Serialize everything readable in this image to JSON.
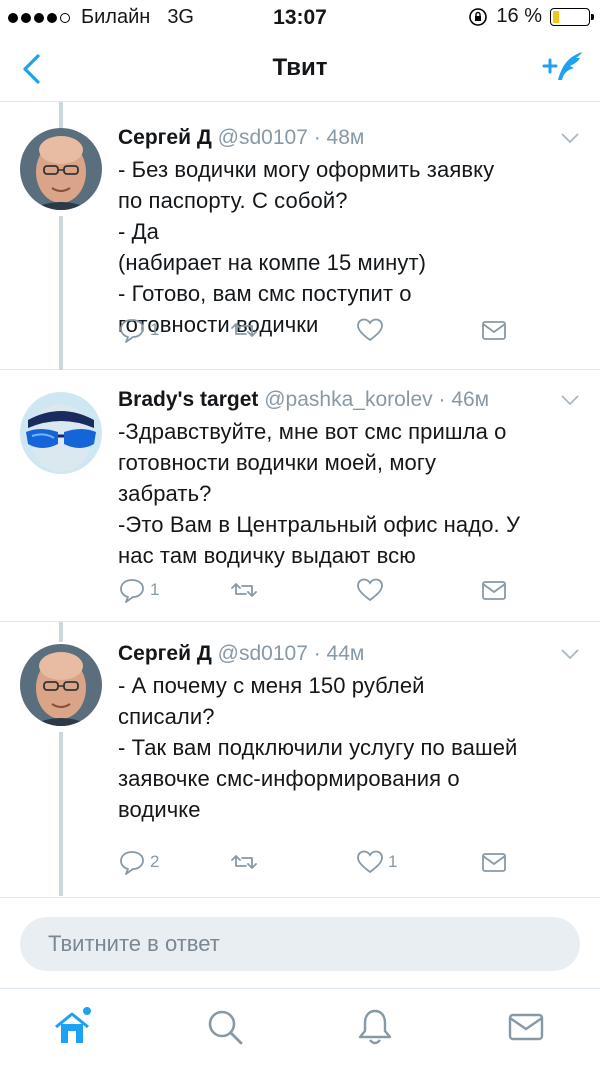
{
  "status_bar": {
    "carrier": "Билайн",
    "network": "3G",
    "time": "13:07",
    "battery_text": "16 %",
    "battery_level": 0.16,
    "signal_bars": 4
  },
  "nav": {
    "title": "Твит",
    "back_icon": "chevron-left-icon",
    "compose_icon": "compose-tweet-icon"
  },
  "tweets": [
    {
      "name": "Сергей Д",
      "handle": "@sd0107",
      "time": "· 48м",
      "text": "- Без водички могу оформить заявку\nпо паспорту. С собой?\n- Да\n(набирает на компе 15 минут)\n- Готово, вам смс поступит о\nготовности водички",
      "replies": "1",
      "retweets": "",
      "likes": "",
      "avatar": "bald-man-glasses"
    },
    {
      "name": "Brady's target",
      "handle": "@pashka_korolev",
      "time": "· 46м",
      "text": "-Здравствуйте, мне вот смс пришла о\nготовности водички моей, могу\nзабрать?\n-Это Вам в Центральный офис надо. У\nнас там водичку выдают всю",
      "replies": "1",
      "retweets": "",
      "likes": "",
      "avatar": "blue-sunglasses"
    },
    {
      "name": "Сергей Д",
      "handle": "@sd0107",
      "time": "· 44м",
      "text": "- А почему с меня 150 рублей\nсписали?\n- Так вам подключили услугу по вашей\nзаявочке смс-информирования о\nводичке",
      "replies": "2",
      "retweets": "",
      "likes": "1",
      "avatar": "bald-man-glasses"
    }
  ],
  "reply": {
    "placeholder": "Твитните в ответ"
  },
  "tab_bar": {
    "items": [
      "home-icon",
      "search-icon",
      "notifications-icon",
      "messages-icon"
    ]
  },
  "colors": {
    "accent": "#1da1f2",
    "muted": "#8899a6",
    "border": "#e1e8ed"
  }
}
